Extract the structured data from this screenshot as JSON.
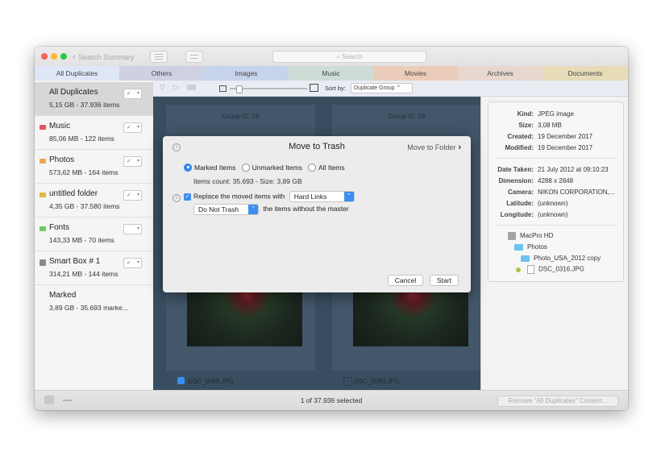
{
  "toolbar": {
    "back_label": "Search Summary",
    "search_placeholder": "Search"
  },
  "tabs": [
    {
      "label": "All Duplicates",
      "color": "#dfe6f8"
    },
    {
      "label": "Others",
      "color": "#d0d0e3"
    },
    {
      "label": "Images",
      "color": "#c6d3ea"
    },
    {
      "label": "Music",
      "color": "#cdddd5"
    },
    {
      "label": "Movies",
      "color": "#ebccba"
    },
    {
      "label": "Archives",
      "color": "#e8d7cf"
    },
    {
      "label": "Documents",
      "color": "#e6dcb8"
    }
  ],
  "sidebar": {
    "items": [
      {
        "title": "All Duplicates",
        "subtitle": "5,15 GB - 37.936 items",
        "icon": "none",
        "checked": true
      },
      {
        "title": "Music",
        "subtitle": "85,06 MB - 122 items",
        "icon": "folder-icon-red",
        "icon_color": "#e5555e",
        "checked": true
      },
      {
        "title": "Photos",
        "subtitle": "573,62 MB - 164 items",
        "icon": "folder-icon-orange",
        "icon_color": "#f0a54a",
        "checked": true
      },
      {
        "title": "untitled folder",
        "subtitle": "4,35 GB - 37.580 items",
        "icon": "folder-icon-yellow",
        "icon_color": "#e5b83a",
        "checked": true
      },
      {
        "title": "Fonts",
        "subtitle": "143,33 MB - 70 items",
        "icon": "folder-icon-green",
        "icon_color": "#6fc964",
        "checked": false
      },
      {
        "title": "Smart Box # 1",
        "subtitle": "314,21 MB - 144 items",
        "icon": "smart-box-icon",
        "icon_color": "#8a8a8a",
        "checked": true
      },
      {
        "title": "Marked",
        "subtitle": "3,89 GB - 35.693 marke...",
        "icon": "none",
        "checked": null
      }
    ]
  },
  "subbar": {
    "sort_label": "Sort by:",
    "sort_value": "Duplicate Group"
  },
  "cards": [
    {
      "group": "Group ID: 18",
      "filename": "DSC_0089.JPG",
      "checked": true
    },
    {
      "group": "Group ID: 18",
      "filename": "DSC_0089.JPG",
      "checked": false
    }
  ],
  "info": {
    "fields": [
      {
        "key": "Kind:",
        "value": "JPEG image"
      },
      {
        "key": "Size:",
        "value": "3,08 MB"
      },
      {
        "key": "Created:",
        "value": "19 December 2017"
      },
      {
        "key": "Modified:",
        "value": "19 December 2017"
      },
      {
        "key": "Date Taken:",
        "value": "21 July 2012 at 09:10:23"
      },
      {
        "key": "Dimension:",
        "value": "4288 x 2848"
      },
      {
        "key": "Camera:",
        "value": "NIKON CORPORATION,..."
      },
      {
        "key": "Latitude:",
        "value": "(unknown)"
      },
      {
        "key": "Longitude:",
        "value": "(unknown)"
      }
    ],
    "path": [
      "MacPro HD",
      "Photos",
      "Photo_USA_2012 copy",
      "DSC_0316.JPG"
    ]
  },
  "status": {
    "selection": "1 of 37.936 selected",
    "remove_button": "Remove \"All Duplicates\" Content..."
  },
  "dialog": {
    "title": "Move to Trash",
    "alt_link": "Move to Folder",
    "radio_options": [
      "Marked Items",
      "Unmarked Items",
      "All Items"
    ],
    "radio_selected": "Marked Items",
    "items_count": "Items count: 35.693 - Size: 3,89 GB",
    "replace_label": "Replace the moved items with",
    "replace_value": "Hard Links",
    "trash_value": "Do Not Trash",
    "trash_suffix": "the items without the master",
    "cancel_label": "Cancel",
    "start_label": "Start"
  }
}
